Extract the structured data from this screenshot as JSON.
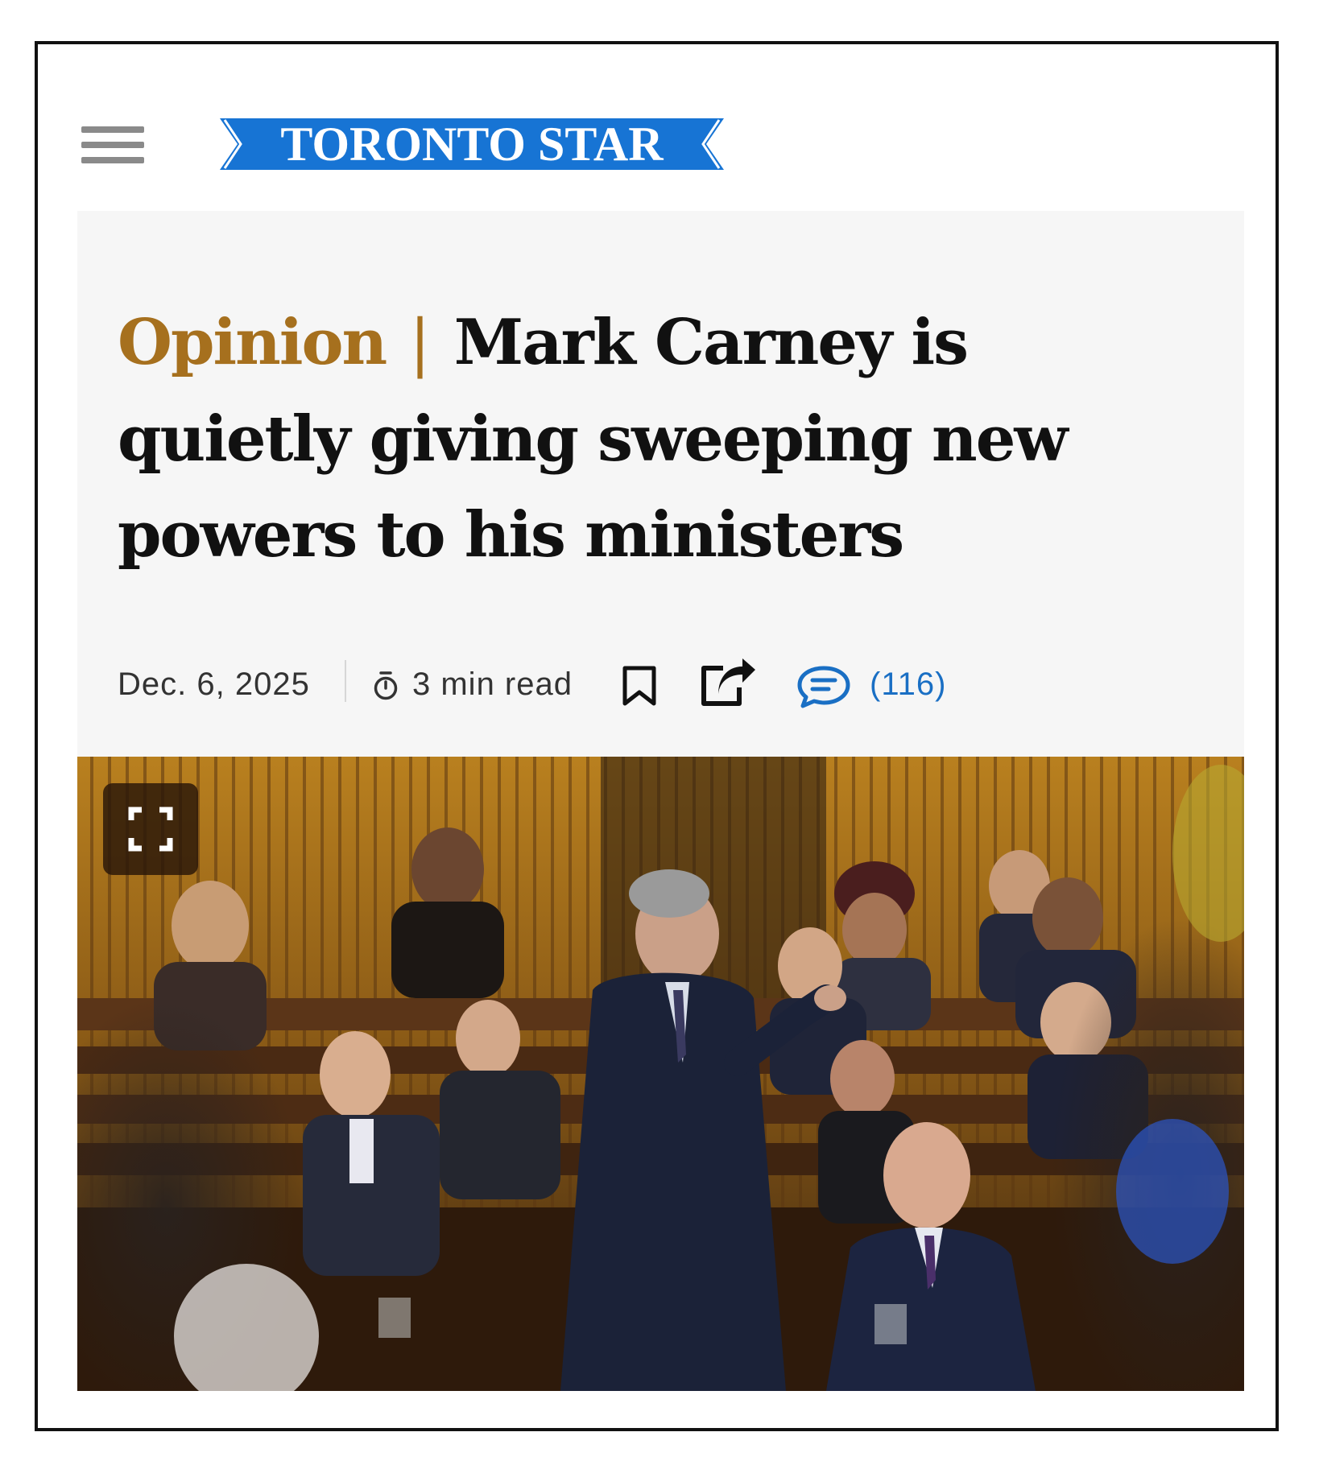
{
  "brand": {
    "name": "TORONTO STAR",
    "color": "#1774d4"
  },
  "header": {
    "menu_icon": "hamburger-menu-icon"
  },
  "article": {
    "label": "Opinion",
    "separator": "|",
    "title": "Mark Carney is quietly giving sweeping new powers to his ministers",
    "date": "Dec. 6, 2025",
    "read_time": "3 min read",
    "comments_count": "(116)"
  },
  "icons": {
    "timer": "timer-icon",
    "bookmark": "bookmark-icon",
    "share": "share-icon",
    "comments": "comment-bubble-icon",
    "expand": "fullscreen-expand-icon"
  },
  "colors": {
    "label": "#a6701e",
    "link": "#1a6fc4",
    "panel_bg": "#f6f6f6"
  }
}
